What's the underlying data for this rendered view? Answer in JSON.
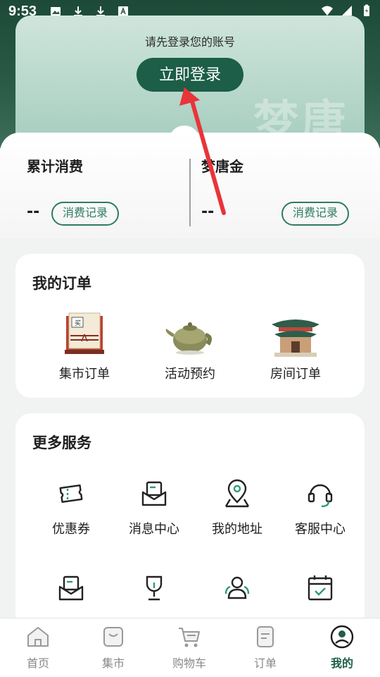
{
  "status_bar": {
    "time": "9:53"
  },
  "login": {
    "prompt": "请先登录您的账号",
    "button_label": "立即登录",
    "watermark": "梦唐"
  },
  "stats": {
    "left": {
      "label": "累计消费",
      "value": "--",
      "button": "消费记录"
    },
    "right": {
      "label": "梦唐金",
      "value": "--",
      "button": "消费记录"
    }
  },
  "orders": {
    "title": "我的订单",
    "items": [
      {
        "label": "集市订单",
        "icon": "market-order-icon"
      },
      {
        "label": "活动预约",
        "icon": "teapot-icon"
      },
      {
        "label": "房间订单",
        "icon": "pavilion-icon"
      }
    ]
  },
  "services": {
    "title": "更多服务",
    "items": [
      {
        "label": "优惠券",
        "icon": "coupon-icon"
      },
      {
        "label": "消息中心",
        "icon": "message-icon"
      },
      {
        "label": "我的地址",
        "icon": "location-icon"
      },
      {
        "label": "客服中心",
        "icon": "headset-icon"
      }
    ]
  },
  "nav": {
    "items": [
      {
        "label": "首页",
        "icon": "home-icon"
      },
      {
        "label": "集市",
        "icon": "market-bag-icon"
      },
      {
        "label": "购物车",
        "icon": "cart-icon"
      },
      {
        "label": "订单",
        "icon": "order-list-icon"
      },
      {
        "label": "我的",
        "icon": "profile-icon"
      }
    ],
    "active_index": 4
  },
  "colors": {
    "brand_green": "#1c5e47",
    "accent_green": "#2f7b62",
    "annotation_red": "#e8353a"
  }
}
